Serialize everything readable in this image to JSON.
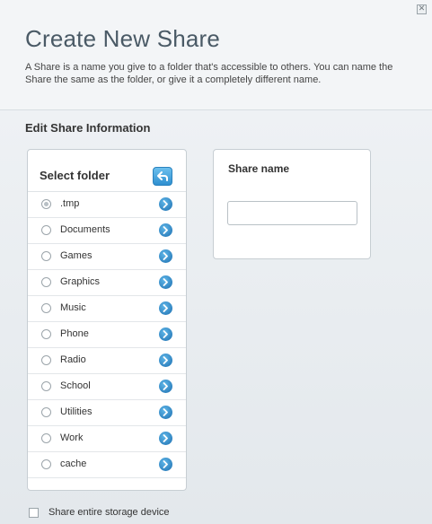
{
  "dialog": {
    "title": "Create New Share",
    "close_icon": "close-icon",
    "description": "A Share is a name you give to a folder that's accessible to others. You can name the Share the same as the folder, or give it a completely different name."
  },
  "section": {
    "title": "Edit Share Information"
  },
  "folder_panel": {
    "title": "Select folder",
    "up_icon": "back-arrow-icon",
    "folders": [
      {
        "label": ".tmp",
        "selected": true
      },
      {
        "label": "Documents",
        "selected": false
      },
      {
        "label": "Games",
        "selected": false
      },
      {
        "label": "Graphics",
        "selected": false
      },
      {
        "label": "Music",
        "selected": false
      },
      {
        "label": "Phone",
        "selected": false
      },
      {
        "label": "Radio",
        "selected": false
      },
      {
        "label": "School",
        "selected": false
      },
      {
        "label": "Utilities",
        "selected": false
      },
      {
        "label": "Work",
        "selected": false
      },
      {
        "label": "cache",
        "selected": false
      }
    ]
  },
  "share_panel": {
    "label": "Share name",
    "input_value": "",
    "input_placeholder": ""
  },
  "options": {
    "share_entire_label": "Share entire storage device",
    "share_entire_checked": false
  },
  "colors": {
    "accent": "#2f8fd0",
    "title": "#4a5a66",
    "background": "#e7ecf0"
  }
}
